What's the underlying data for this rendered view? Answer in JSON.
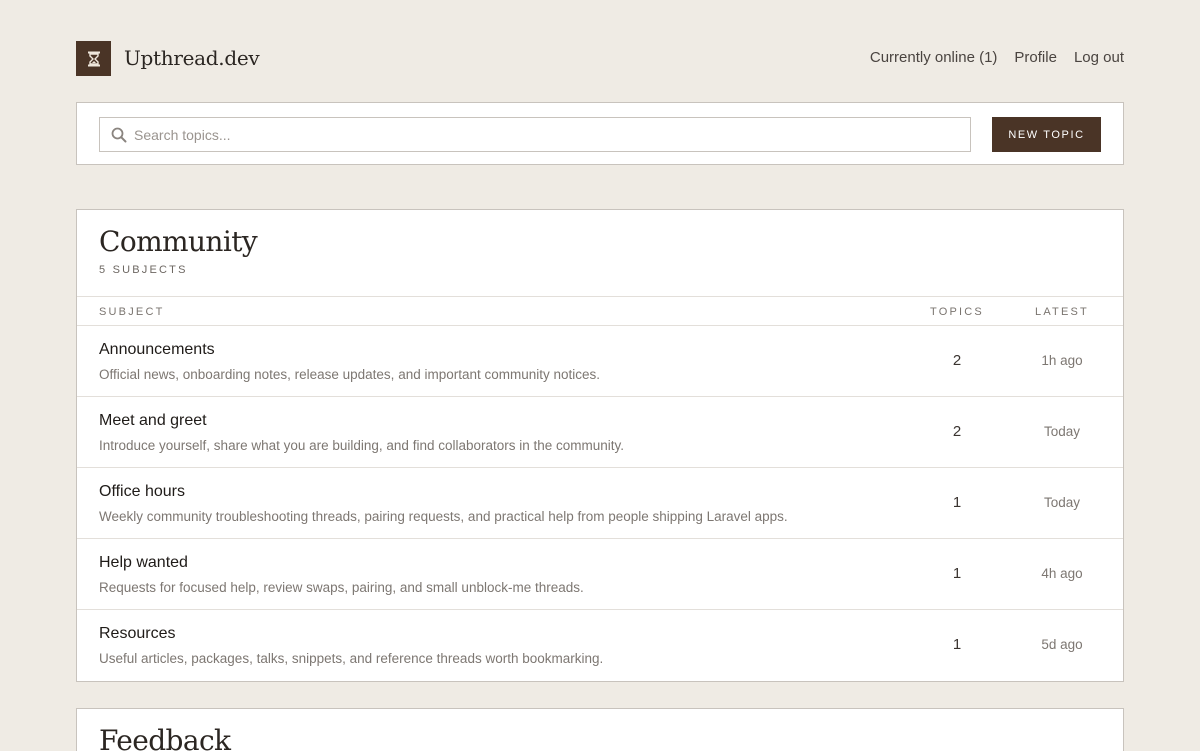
{
  "brand": {
    "name": "Upthread.dev"
  },
  "nav": {
    "online": "Currently online (1)",
    "profile": "Profile",
    "logout": "Log out"
  },
  "search": {
    "placeholder": "Search topics..."
  },
  "new_topic_label": "NEW TOPIC",
  "community": {
    "title": "Community",
    "subtitle": "5 SUBJECTS",
    "columns": {
      "subject": "SUBJECT",
      "topics": "TOPICS",
      "latest": "LATEST"
    },
    "rows": [
      {
        "name": "Announcements",
        "desc": "Official news, onboarding notes, release updates, and important community notices.",
        "topics": "2",
        "latest": "1h ago"
      },
      {
        "name": "Meet and greet",
        "desc": "Introduce yourself, share what you are building, and find collaborators in the community.",
        "topics": "2",
        "latest": "Today"
      },
      {
        "name": "Office hours",
        "desc": "Weekly community troubleshooting threads, pairing requests, and practical help from people shipping Laravel apps.",
        "topics": "1",
        "latest": "Today"
      },
      {
        "name": "Help wanted",
        "desc": "Requests for focused help, review swaps, pairing, and small unblock-me threads.",
        "topics": "1",
        "latest": "4h ago"
      },
      {
        "name": "Resources",
        "desc": "Useful articles, packages, talks, snippets, and reference threads worth bookmarking.",
        "topics": "1",
        "latest": "5d ago"
      }
    ]
  },
  "feedback": {
    "title": "Feedback"
  },
  "colors": {
    "background": "#efebe4",
    "accent": "#4a3426",
    "card": "#ffffff",
    "border": "#c8c3bd"
  },
  "icons": {
    "logo": "hourglass-icon",
    "search": "search-icon"
  }
}
